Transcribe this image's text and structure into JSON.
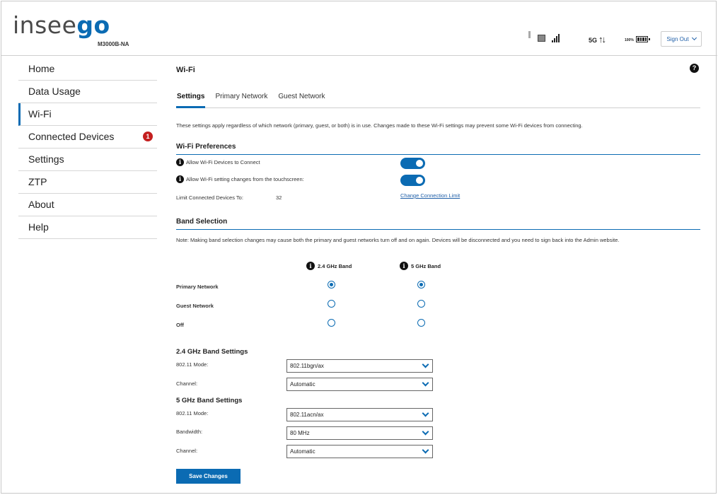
{
  "header": {
    "logo_prefix": "insee",
    "logo_suffix": "go",
    "model": "M3000B-NA",
    "network_type": "5G",
    "battery_percent": "100%",
    "signout_label": "Sign Out"
  },
  "sidebar": {
    "items": [
      {
        "label": "Home"
      },
      {
        "label": "Data Usage"
      },
      {
        "label": "Wi-Fi"
      },
      {
        "label": "Connected Devices",
        "badge": "1"
      },
      {
        "label": "Settings"
      },
      {
        "label": "ZTP"
      },
      {
        "label": "About"
      },
      {
        "label": "Help"
      }
    ]
  },
  "main": {
    "title": "Wi-Fi",
    "help": "?",
    "tabs": [
      {
        "label": "Settings"
      },
      {
        "label": "Primary Network"
      },
      {
        "label": "Guest Network"
      }
    ],
    "intro": "These settings apply regardless of which network (primary, guest, or both) is in use. Changes made to these Wi-Fi settings may prevent some Wi-Fi devices from connecting.",
    "preferences": {
      "title": "Wi-Fi Preferences",
      "allow_connect": "Allow Wi-Fi Devices to Connect",
      "allow_touchscreen": "Allow Wi-Fi setting changes from the touchscreen:",
      "limit_label": "Limit Connected Devices To:",
      "limit_value": "32",
      "change_limit_link": "Change Connection Limit"
    },
    "band": {
      "title": "Band Selection",
      "note": "Note: Making band selection changes may cause both the primary and guest networks turn off and on again. Devices will be disconnected and you need to sign back into the Admin website.",
      "col_24": "2.4 GHz Band",
      "col_5": "5 GHz Band",
      "rows": [
        {
          "label": "Primary Network"
        },
        {
          "label": "Guest Network"
        },
        {
          "label": "Off"
        }
      ]
    },
    "band24": {
      "title": "2.4 GHz Band Settings",
      "mode_label": "802.11 Mode:",
      "mode_value": "802.11bgn/ax",
      "channel_label": "Channel:",
      "channel_value": "Automatic"
    },
    "band5": {
      "title": "5 GHz Band Settings",
      "mode_label": "802.11 Mode:",
      "mode_value": "802.11acn/ax",
      "bandwidth_label": "Bandwidth:",
      "bandwidth_value": "80 MHz",
      "channel_label": "Channel:",
      "channel_value": "Automatic"
    },
    "save_label": "Save Changes"
  }
}
